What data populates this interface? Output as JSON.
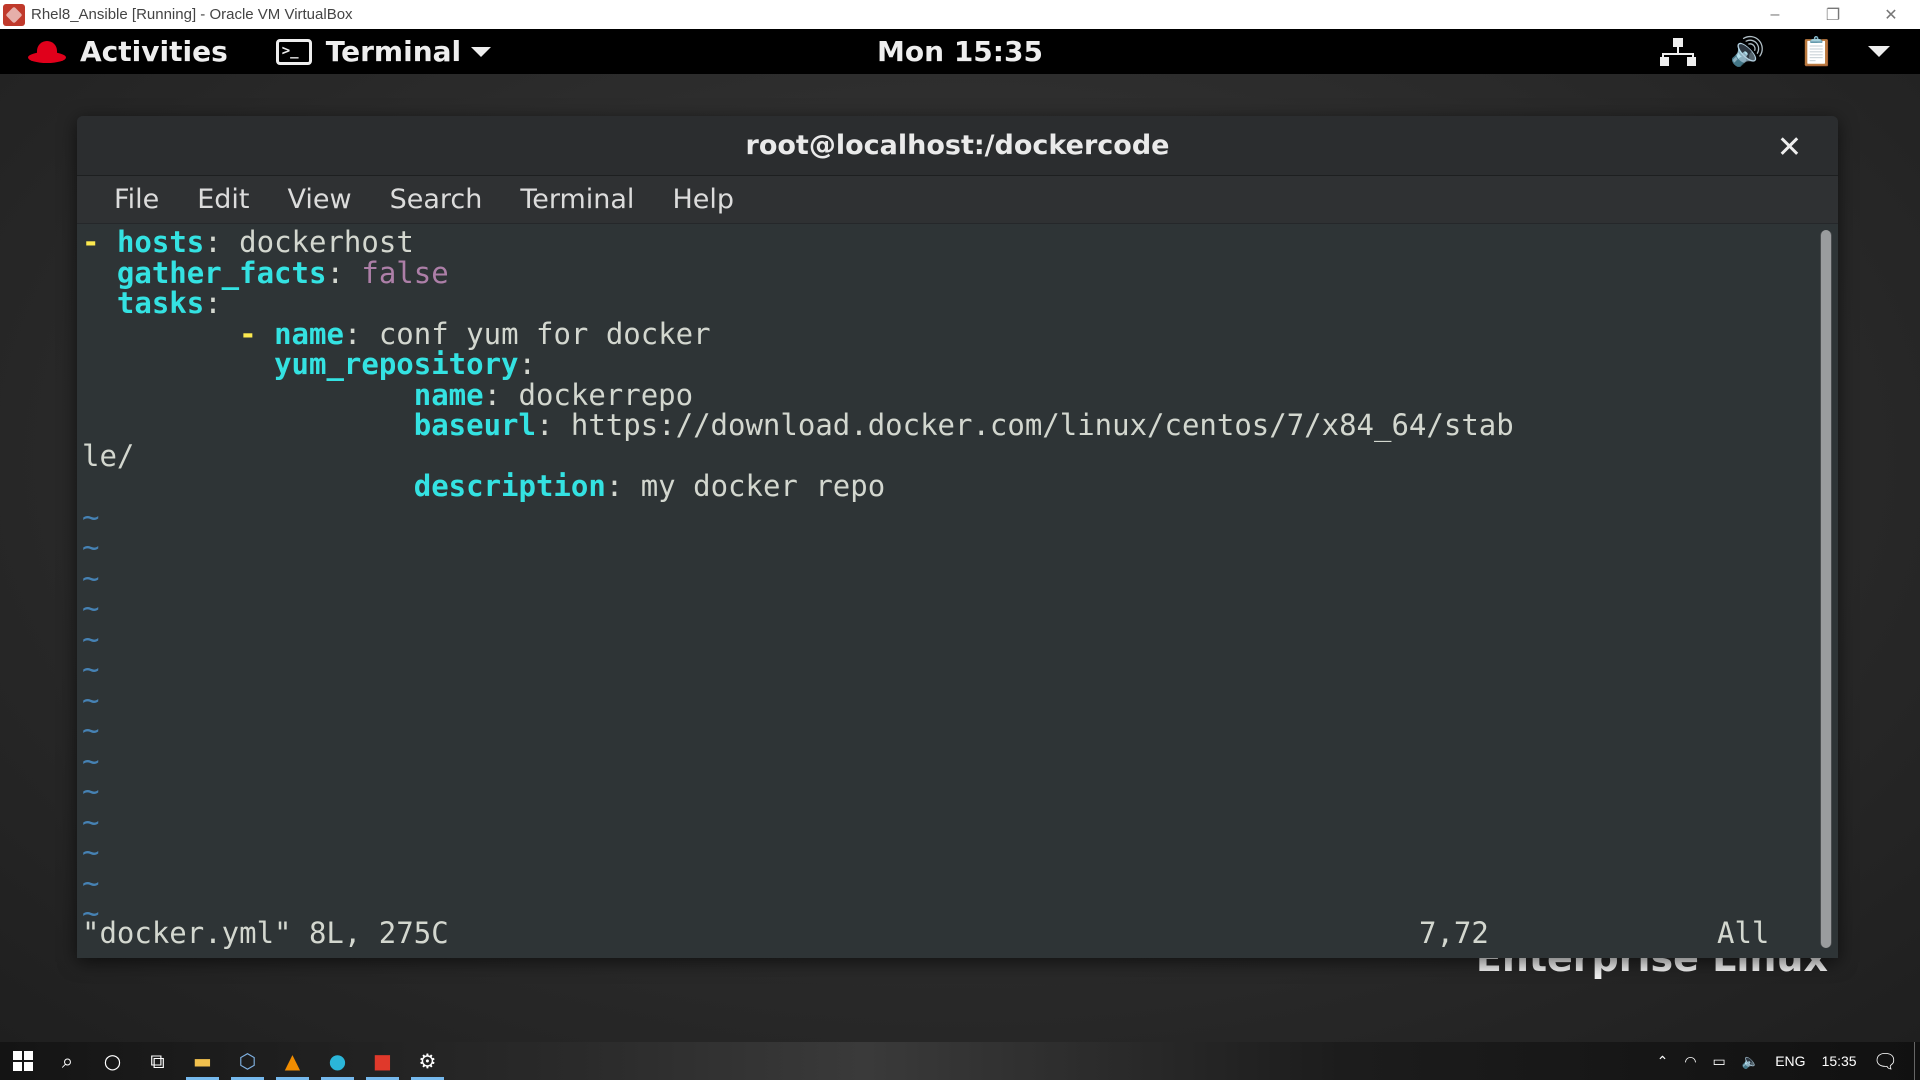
{
  "vbox": {
    "title": "Rhel8_Ansible [Running] - Oracle VM VirtualBox",
    "minimize": "–",
    "restore": "❐",
    "close": "✕"
  },
  "gnome": {
    "activities": "Activities",
    "app_name": "Terminal",
    "clock": "Mon 15:35"
  },
  "terminal": {
    "title": "root@localhost:/dockercode",
    "close": "✕",
    "menu": [
      "File",
      "Edit",
      "View",
      "Search",
      "Terminal",
      "Help"
    ]
  },
  "editor": {
    "lines": {
      "l1_dash": "-",
      "l1_key": "hosts",
      "l1_val": " dockerhost",
      "l2_key": "gather_facts",
      "l2_val": "false",
      "l3_key": "tasks",
      "l4_dash": "-",
      "l4_key": "name",
      "l4_val": " conf yum for docker",
      "l5_key": "yum_repository",
      "l6_key": "name",
      "l6_val": " dockerrepo",
      "l7_key": "baseurl",
      "l7_val": " https://download.docker.com/linux/centos/7/x84_64/stab",
      "l7_wrap": "le/",
      "l8_key": "description",
      "l8_val": " my docker repo"
    },
    "tilde": "~",
    "tilde_count": 14,
    "status_file": "\"docker.yml\" 8L, 275C",
    "status_pos": "7,72",
    "status_scroll": "All"
  },
  "wallpaper_text": "Enterprise Linux",
  "taskbar": {
    "lang": "ENG",
    "time": "15:35"
  },
  "colors": {
    "yaml_key": "#34e2e2",
    "yaml_dash": "#fce94f",
    "yaml_bool": "#ad7fa8",
    "terminal_bg": "#2e3436"
  }
}
